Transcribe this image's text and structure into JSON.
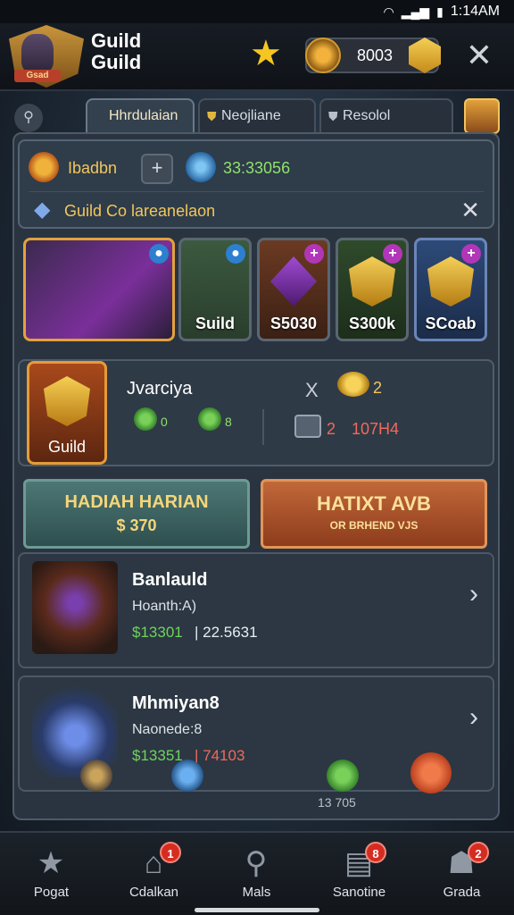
{
  "statusbar": {
    "time": "1:14AM"
  },
  "header": {
    "emblem_tag": "Gsad",
    "title": "Guild Guild",
    "currency_value": "8003"
  },
  "tabs": [
    {
      "label": "Hhrdulaian"
    },
    {
      "label": "Neojliane"
    },
    {
      "label": "Resolol"
    }
  ],
  "info": {
    "label": "Ibadbn",
    "value": "33:33056",
    "sub_label": "Guild Co lareanelaon"
  },
  "cards": [
    {
      "label": ""
    },
    {
      "label": "Suild"
    },
    {
      "label": "S5030"
    },
    {
      "label": "S300k"
    },
    {
      "label": "SCoab"
    }
  ],
  "guild": {
    "icon_label": "Guild",
    "name": "Jvarciya",
    "mini_val_1": "0",
    "mini_val_2": "8",
    "x_mark": "X",
    "coin_value": "2",
    "box_value": "2",
    "box_value_2": "107H4"
  },
  "buttons": {
    "daily_title": "HADIAH HARIAN",
    "daily_amount": "$ 370",
    "right_title": "HATIXT AVB",
    "right_sub": "OR BRHEND VJS"
  },
  "list": [
    {
      "title": "Banlauld",
      "sub": "Hoanth:A)",
      "green": "$13301",
      "white": "| 22.5631"
    },
    {
      "title": "Mhmiyan8",
      "sub": "Naonede:8",
      "green": "$13351",
      "red": "| 74103"
    }
  ],
  "bottom_icon_value": "13 705",
  "nav": [
    {
      "label": "Pogat",
      "badge": ""
    },
    {
      "label": "Cdalkan",
      "badge": "1"
    },
    {
      "label": "Mals",
      "badge": ""
    },
    {
      "label": "Sanotine",
      "badge": "8"
    },
    {
      "label": "Grada",
      "badge": "2"
    }
  ]
}
